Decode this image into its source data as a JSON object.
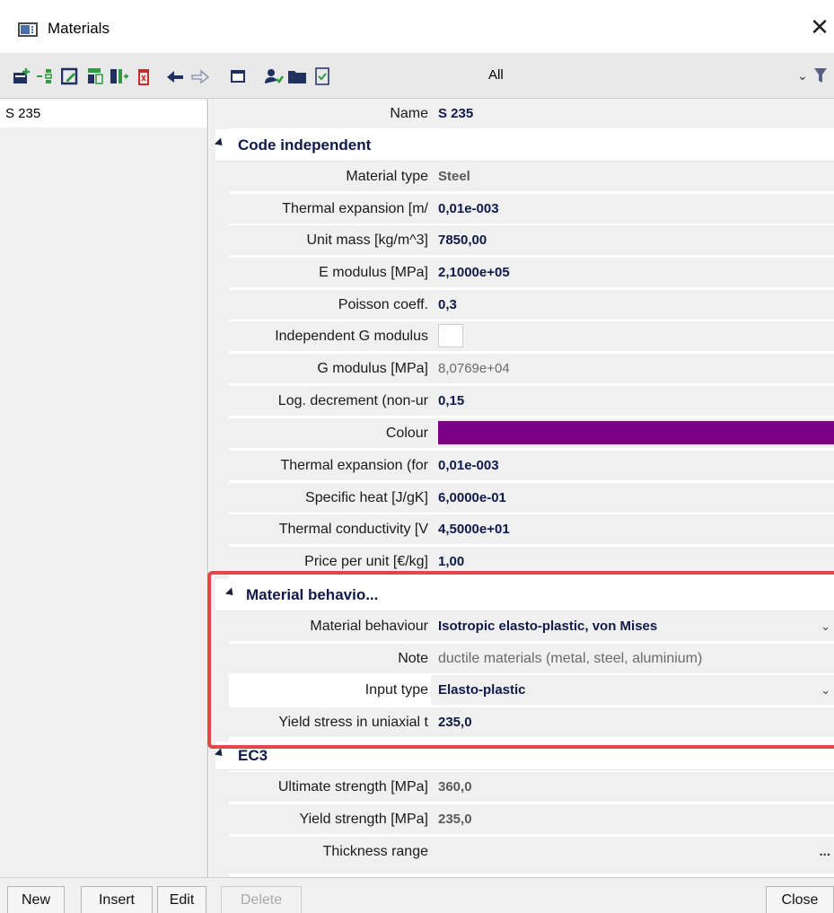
{
  "window": {
    "title": "Materials"
  },
  "toolbar": {
    "filter_value": "All",
    "icons": [
      "new-material-icon",
      "insert-material-icon",
      "edit-icon",
      "copy-icon",
      "import-icon",
      "delete-icon",
      "undo-icon",
      "redo-icon",
      "table-icon",
      "users-icon",
      "save-icon",
      "checklist-icon"
    ]
  },
  "list": {
    "items": [
      {
        "label": "S 235"
      }
    ]
  },
  "properties": {
    "name": {
      "label": "Name",
      "value": "S 235"
    },
    "section_code_independent": "Code independent",
    "material_type": {
      "label": "Material type",
      "value": "Steel"
    },
    "thermal_expansion": {
      "label": "Thermal expansion  [m/",
      "value": "0,01e-003"
    },
    "unit_mass": {
      "label": "Unit mass [kg/m^3]",
      "value": "7850,00"
    },
    "e_modulus": {
      "label": "E modulus [MPa]",
      "value": "2,1000e+05"
    },
    "poisson": {
      "label": "Poisson coeff.",
      "value": "0,3"
    },
    "independent_g": {
      "label": "Independent G modulus"
    },
    "g_modulus": {
      "label": "G modulus [MPa]",
      "value": "8,0769e+04"
    },
    "log_decrement": {
      "label": "Log. decrement (non-ur",
      "value": "0,15"
    },
    "colour": {
      "label": "Colour",
      "color": "#7b0083"
    },
    "thermal_expansion_fire": {
      "label": "Thermal expansion (for",
      "value": "0,01e-003"
    },
    "specific_heat": {
      "label": "Specific heat [J/gK]",
      "value": "6,0000e-01"
    },
    "thermal_conductivity": {
      "label": "Thermal conductivity [V",
      "value": "4,5000e+01"
    },
    "price": {
      "label": "Price per unit [€/kg]",
      "value": "1,00"
    },
    "section_material_behaviour": "Material behavio...",
    "material_behaviour": {
      "label": "Material behaviour",
      "value": "Isotropic elasto-plastic, von Mises"
    },
    "note": {
      "label": "Note",
      "value": "ductile materials (metal, steel, aluminium)"
    },
    "input_type": {
      "label": "Input type",
      "value": "Elasto-plastic"
    },
    "yield_stress_uniaxial": {
      "label": "Yield stress in uniaxial t",
      "value": "235,0"
    },
    "section_ec3": "EC3",
    "ultimate_strength": {
      "label": "Ultimate strength [MPa]",
      "value": "360,0"
    },
    "yield_strength": {
      "label": "Yield strength [MPa]",
      "value": "235,0"
    },
    "thickness_range": {
      "label": "Thickness range",
      "value": "..."
    }
  },
  "buttons": {
    "new": "New",
    "insert": "Insert",
    "edit": "Edit",
    "delete": "Delete",
    "close": "Close"
  },
  "colors": {
    "highlight": "#e04848",
    "value_text": "#0f1a4a",
    "colour_swatch": "#7b0083"
  }
}
